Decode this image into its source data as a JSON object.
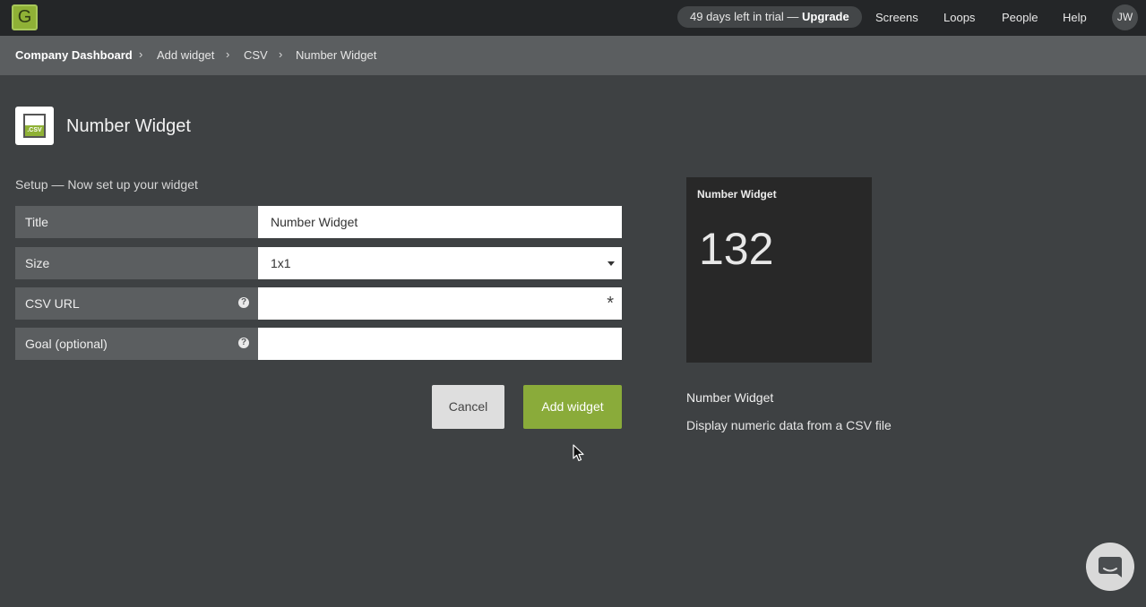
{
  "topbar": {
    "logo_letter": "G",
    "trial_text": "49 days left in trial — ",
    "trial_upgrade": "Upgrade",
    "nav": [
      "Screens",
      "Loops",
      "People",
      "Help"
    ],
    "avatar_initials": "JW"
  },
  "breadcrumb": [
    "Company Dashboard",
    "Add widget",
    "CSV",
    "Number Widget"
  ],
  "header": {
    "title": "Number Widget",
    "icon_label": ".CSV"
  },
  "form": {
    "setup_label": "Setup — Now set up your widget",
    "title_label": "Title",
    "title_value": "Number Widget",
    "size_label": "Size",
    "size_value": "1x1",
    "csv_url_label": "CSV URL",
    "csv_url_value": "",
    "goal_label": "Goal (optional)",
    "goal_value": "",
    "help_glyph": "?",
    "required_glyph": "*",
    "cancel_label": "Cancel",
    "add_label": "Add widget"
  },
  "preview": {
    "title": "Number Widget",
    "number": "132",
    "name": "Number Widget",
    "description": "Display numeric data from a CSV file"
  },
  "colors": {
    "accent": "#8aab3a",
    "background": "#3e4143",
    "topbar": "#242628"
  }
}
